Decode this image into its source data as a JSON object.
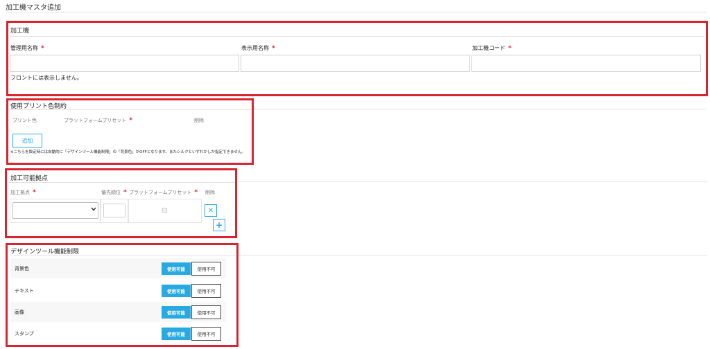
{
  "page": {
    "title": "加工機マスタ追加"
  },
  "machine": {
    "section_title": "加工機",
    "fields": [
      {
        "label": "管理用名称",
        "value": ""
      },
      {
        "label": "表示用名称",
        "value": ""
      },
      {
        "label": "加工機コード",
        "value": ""
      }
    ],
    "required_mark": "*",
    "note": "フロントには表示しません。"
  },
  "print_color": {
    "section_title": "使用プリント色制約",
    "columns": [
      "プリント色",
      "プラットフォームプリセット",
      "削除"
    ],
    "add_label": "追加",
    "note": "※こちらを設定時には自動的に「デザインツール機能制限」の「背景色」がOFFとなります。またシルクといずれかしか指定できません。"
  },
  "locations": {
    "section_title": "加工可能拠点",
    "columns": [
      "加工拠点",
      "優先順位",
      "プラットフォームプリセット",
      "削除"
    ],
    "rows": [
      {
        "location": "",
        "priority": "",
        "preset_checked": false
      }
    ],
    "delete_glyph": "✕",
    "add_glyph": "+"
  },
  "design_tool": {
    "section_title": "デザインツール機能制限",
    "enable_label": "使用可能",
    "disable_label": "使用不可",
    "features": [
      {
        "label": "背景色"
      },
      {
        "label": "テキスト"
      },
      {
        "label": "画像"
      },
      {
        "label": "スタンプ"
      }
    ]
  },
  "colors": {
    "accent": "#29a9e1",
    "highlight": "#d9232e",
    "required": "#d9232e"
  }
}
